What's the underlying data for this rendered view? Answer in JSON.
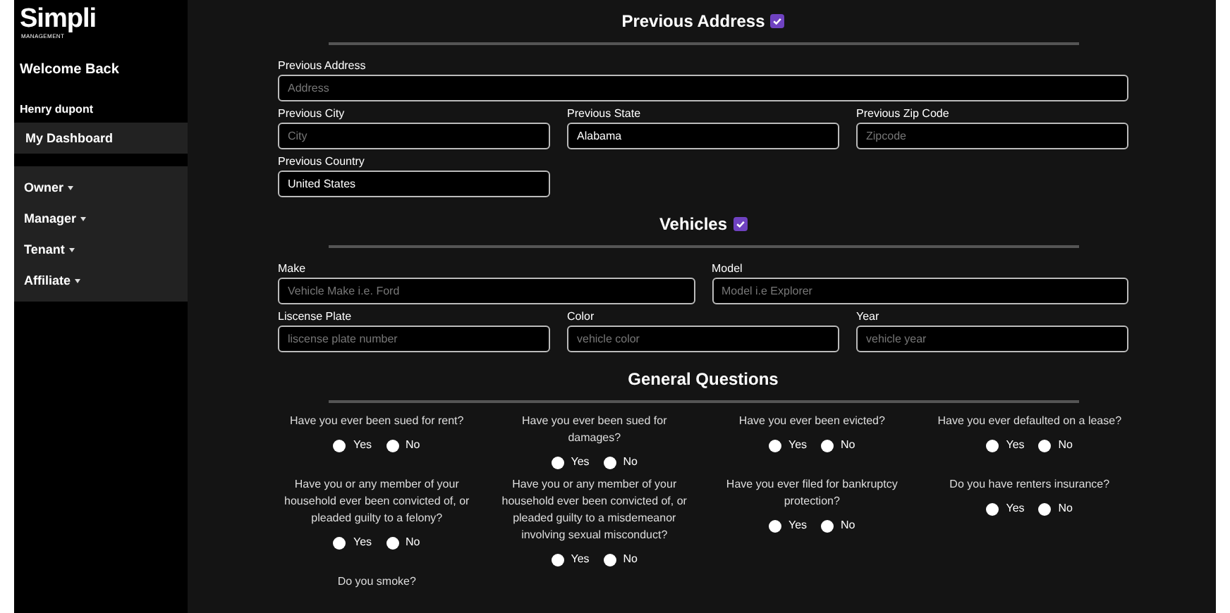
{
  "sidebar": {
    "logo": {
      "name": "Simpli",
      "subtitle": "MANAGEMENT"
    },
    "welcome": "Welcome Back",
    "user": "Henry dupont",
    "dashboard": {
      "label": "My Dashboard",
      "selected": true
    },
    "menu": [
      {
        "label": "Owner",
        "expanded": false
      },
      {
        "label": "Manager",
        "expanded": false
      },
      {
        "label": "Tenant",
        "expanded": false
      },
      {
        "label": "Affiliate",
        "expanded": false
      }
    ]
  },
  "sections": [
    {
      "title": "Previous Address",
      "checked": true,
      "rows": [
        [
          {
            "label": "Previous Address",
            "placeholder": "Address"
          }
        ],
        [
          {
            "label": "Previous City",
            "placeholder": "City"
          },
          {
            "label": "Previous State",
            "value": "Alabama"
          },
          {
            "label": "Previous Zip Code",
            "placeholder": "Zipcode"
          }
        ],
        [
          {
            "label": "Previous Country",
            "value": "United States"
          }
        ]
      ]
    },
    {
      "title": "Vehicles",
      "checked": true,
      "rows": [
        [
          {
            "label": "Make",
            "placeholder": "Vehicle Make i.e. Ford"
          },
          {
            "label": "Model",
            "placeholder": "Model i.e Explorer"
          }
        ],
        [
          {
            "label": "Liscense Plate",
            "placeholder": "liscense plate number"
          },
          {
            "label": "Color",
            "placeholder": "vehicle color"
          },
          {
            "label": "Year",
            "placeholder": "vehicle year"
          }
        ]
      ]
    }
  ],
  "general_questions": {
    "title": "General Questions",
    "questions": [
      {
        "text": "Have you ever been sued for rent?",
        "options": [
          {
            "label": "Yes",
            "selected": false
          },
          {
            "label": "No",
            "selected": false
          }
        ]
      },
      {
        "text": "Have you ever been sued for damages?",
        "options": [
          {
            "label": "Yes",
            "selected": false
          },
          {
            "label": "No",
            "selected": false
          }
        ]
      },
      {
        "text": "Have you ever been evicted?",
        "options": [
          {
            "label": "Yes",
            "selected": false
          },
          {
            "label": "No",
            "selected": false
          }
        ]
      },
      {
        "text": "Have you ever defaulted on a lease?",
        "options": [
          {
            "label": "Yes",
            "selected": false
          },
          {
            "label": "No",
            "selected": false
          }
        ]
      },
      {
        "text": "Have you or any member of your household ever been convicted of, or pleaded guilty to a felony?",
        "options": [
          {
            "label": "Yes",
            "selected": false
          },
          {
            "label": "No",
            "selected": false
          }
        ]
      },
      {
        "text": "Have you or any member of your household ever been convicted of, or pleaded guilty to a misdemeanor involving sexual misconduct?",
        "options": [
          {
            "label": "Yes",
            "selected": false
          },
          {
            "label": "No",
            "selected": false
          }
        ]
      },
      {
        "text": "Have you ever filed for bankruptcy protection?",
        "options": [
          {
            "label": "Yes",
            "selected": false
          },
          {
            "label": "No",
            "selected": false
          }
        ]
      },
      {
        "text": "Do you have renters insurance?",
        "options": [
          {
            "label": "Yes",
            "selected": false
          },
          {
            "label": "No",
            "selected": false
          }
        ]
      },
      {
        "text": "Do you smoke?"
      }
    ]
  }
}
